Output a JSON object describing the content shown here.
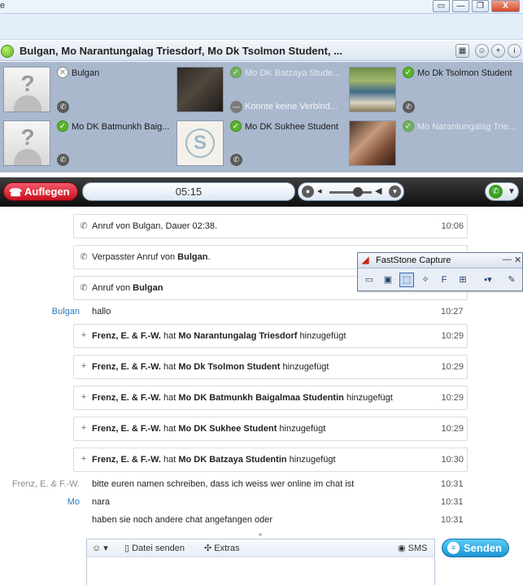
{
  "window": {
    "title_stub": "e",
    "restore_icon": "restore-icon",
    "minimize_label": "—",
    "maximize_label": "❐",
    "close_label": "X"
  },
  "conversation": {
    "title": "Bulgan, Mo Narantungalag Triesdorf, Mo Dk Tsolmon Student, ...",
    "header_icons": [
      "dial-pad-icon",
      "contacts-icon",
      "add-icon",
      "info-icon"
    ]
  },
  "participants": [
    {
      "name": "Bulgan",
      "status": "offline",
      "avatar": "default",
      "dimmed": false
    },
    {
      "name": "Mo DK Batzaya Stude...",
      "status": "online",
      "avatar": "photo",
      "dimmed": true,
      "note": "Konnte keine Verbind..."
    },
    {
      "name": "Mo Dk Tsolmon Student",
      "status": "online",
      "avatar": "photo",
      "dimmed": false
    },
    {
      "name": "Mo DK Batmunkh Baig...",
      "status": "online",
      "avatar": "default",
      "dimmed": false
    },
    {
      "name": "Mo DK Sukhee Student",
      "status": "online",
      "avatar": "skype",
      "dimmed": false
    },
    {
      "name": "Mo Narantungalag Trie...",
      "status": "online",
      "avatar": "photo",
      "dimmed": true
    }
  ],
  "call": {
    "hangup_label": "Auflegen",
    "duration": "05:15"
  },
  "faststone": {
    "title": "FastStone Capture",
    "minimize": "—",
    "close": "✕"
  },
  "system_events": [
    {
      "icon": "phone-icon",
      "pre": "Anruf von Bulgan, Dauer 02:38.",
      "bold": "",
      "post": "",
      "time": "10:06"
    },
    {
      "icon": "phone-icon",
      "pre": "Verpasster Anruf von ",
      "bold": "Bulgan",
      "post": ".",
      "time": ""
    },
    {
      "icon": "phone-icon",
      "pre": "Anruf von ",
      "bold": "Bulgan",
      "post": "",
      "time": ""
    }
  ],
  "messages_1": [
    {
      "sender": "Bulgan",
      "text": "hallo",
      "time": "10:27"
    }
  ],
  "added_events": [
    {
      "actor": "Frenz, E. & F.-W.",
      "mid": " hat ",
      "target": "Mo Narantungalag Triesdorf",
      "post": " hinzugefügt",
      "time": "10:29"
    },
    {
      "actor": "Frenz, E. & F.-W.",
      "mid": " hat ",
      "target": "Mo Dk Tsolmon Student",
      "post": " hinzugefügt",
      "time": "10:29"
    },
    {
      "actor": "Frenz, E. & F.-W.",
      "mid": " hat ",
      "target": "Mo DK Batmunkh Baigalmaa Studentin",
      "post": " hinzugefügt",
      "time": "10:29"
    },
    {
      "actor": "Frenz, E. & F.-W.",
      "mid": " hat ",
      "target": "Mo DK Sukhee Student",
      "post": " hinzugefügt",
      "time": "10:29"
    },
    {
      "actor": "Frenz, E. & F.-W.",
      "mid": " hat ",
      "target": "Mo DK Batzaya Studentin",
      "post": " hinzugefügt",
      "time": "10:30"
    }
  ],
  "messages_2": [
    {
      "sender": "Frenz, E. & F.-W.",
      "text": "bitte euren namen schreiben, dass ich weiss wer online im chat ist",
      "time": "10:31"
    },
    {
      "sender": "Mo",
      "text": "nara",
      "time": "10:31"
    },
    {
      "sender": "",
      "text": "haben sie noch andere chat angefangen oder",
      "time": "10:31"
    }
  ],
  "input": {
    "emoticon_label": "☺ ▾",
    "send_file_label": "Datei senden",
    "extras_label": "Extras",
    "sms_label": "SMS",
    "send_label": "Senden"
  }
}
